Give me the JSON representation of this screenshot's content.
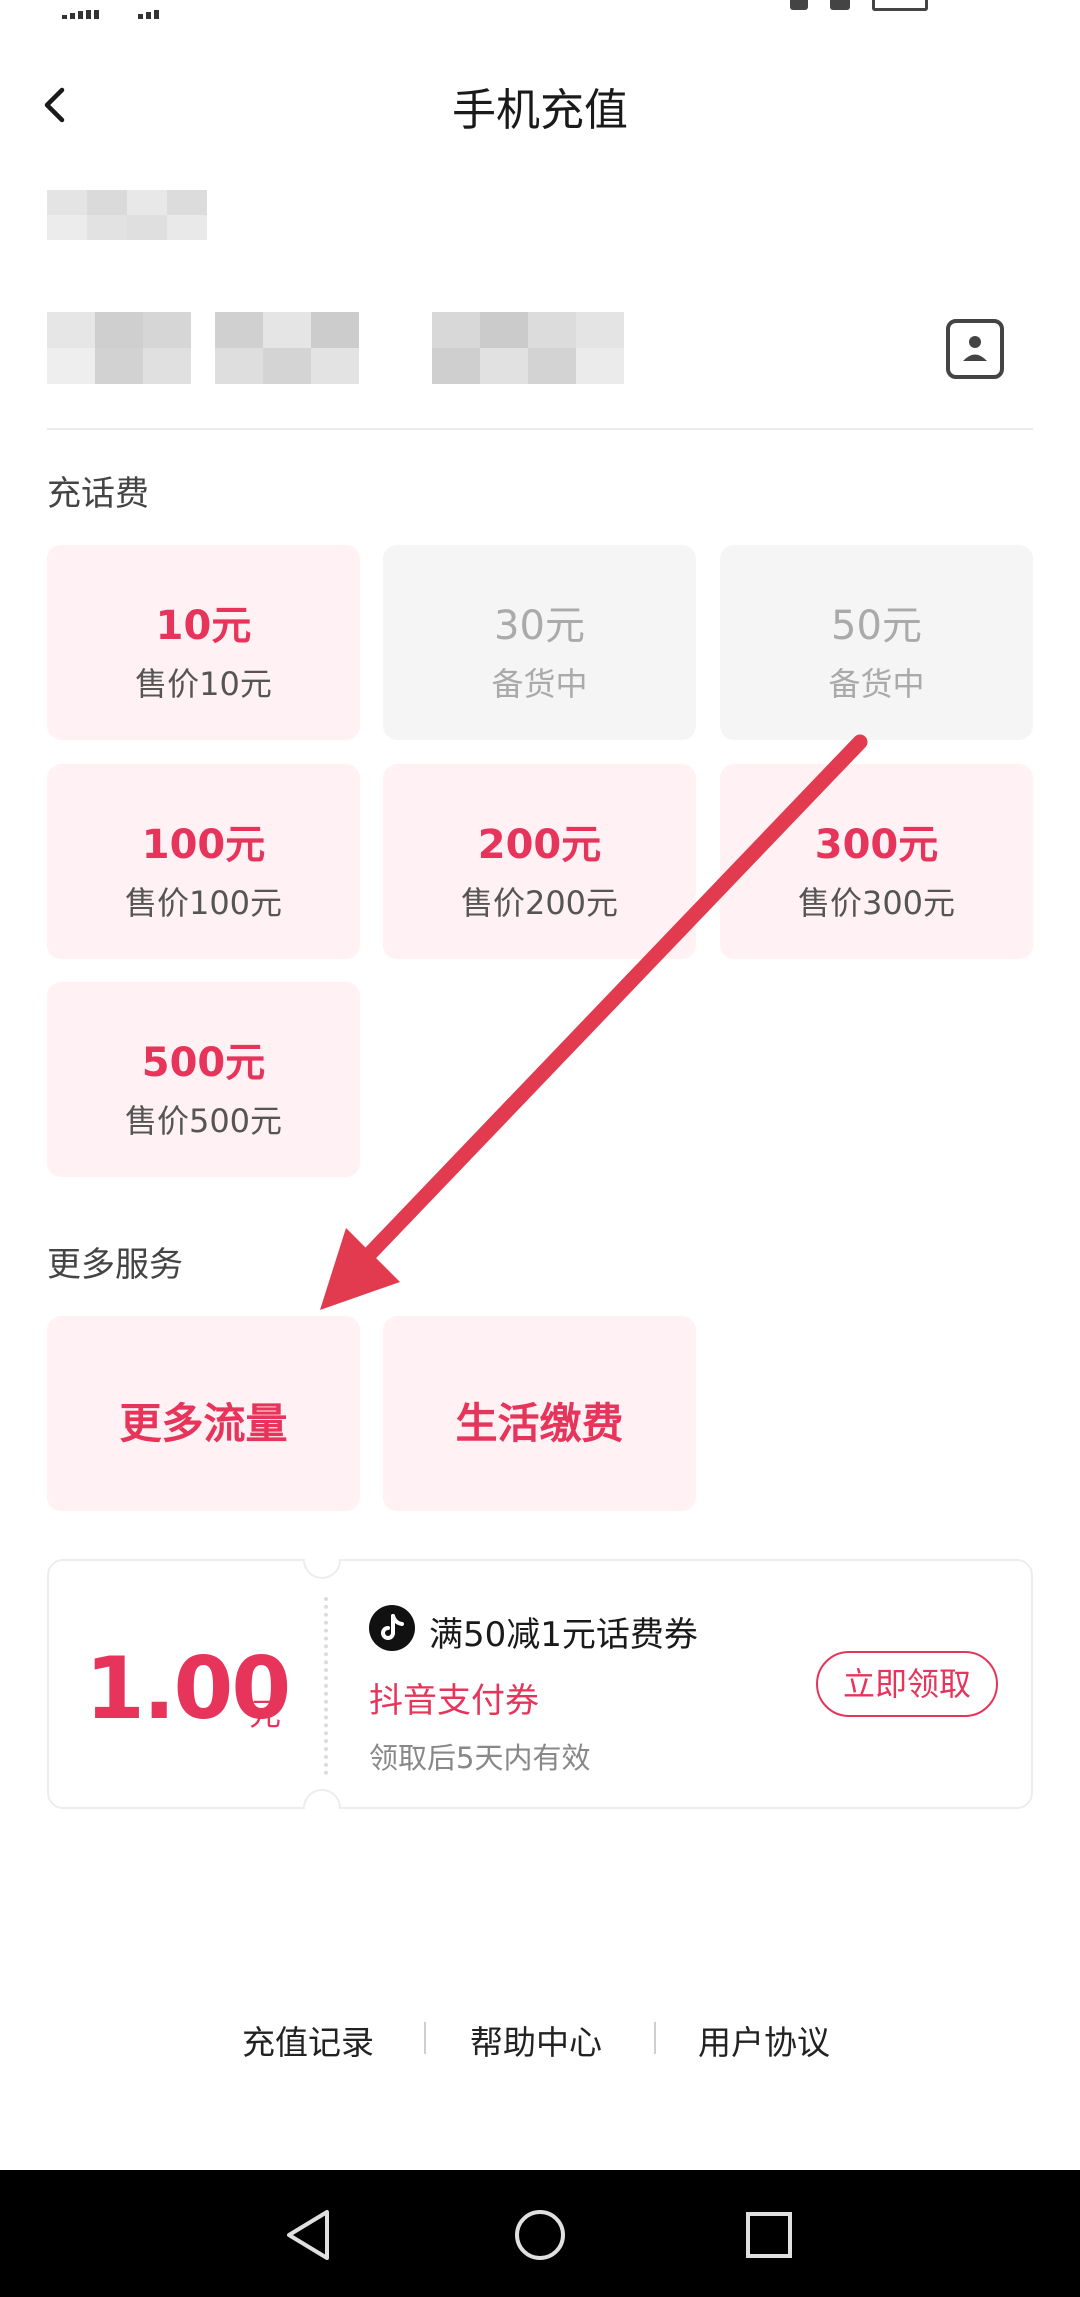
{
  "header": {
    "title": "手机充值",
    "back_icon": "chevron-left-icon",
    "contact_icon": "contact-book-icon"
  },
  "recharge": {
    "label": "充话费",
    "options": [
      {
        "amount": "10元",
        "sub": "售价10元",
        "state": "available"
      },
      {
        "amount": "30元",
        "sub": "备货中",
        "state": "disabled"
      },
      {
        "amount": "50元",
        "sub": "备货中",
        "state": "disabled"
      },
      {
        "amount": "100元",
        "sub": "售价100元",
        "state": "available"
      },
      {
        "amount": "200元",
        "sub": "售价200元",
        "state": "available"
      },
      {
        "amount": "300元",
        "sub": "售价300元",
        "state": "available"
      },
      {
        "amount": "500元",
        "sub": "售价500元",
        "state": "available"
      }
    ]
  },
  "services": {
    "label": "更多服务",
    "items": [
      "更多流量",
      "生活缴费"
    ]
  },
  "coupon": {
    "value": "1.00",
    "unit": "元",
    "title": "满50减1元话费券",
    "name": "抖音支付券",
    "note": "领取后5天内有效",
    "button": "立即领取",
    "logo_icon": "douyin-logo-icon"
  },
  "footer": {
    "links": [
      "充值记录",
      "帮助中心",
      "用户协议"
    ]
  },
  "colors": {
    "accent": "#e7345b",
    "card_bg": "#fff1f4",
    "disabled_bg": "#f5f5f5",
    "annotation_arrow": "#e23a4e"
  }
}
